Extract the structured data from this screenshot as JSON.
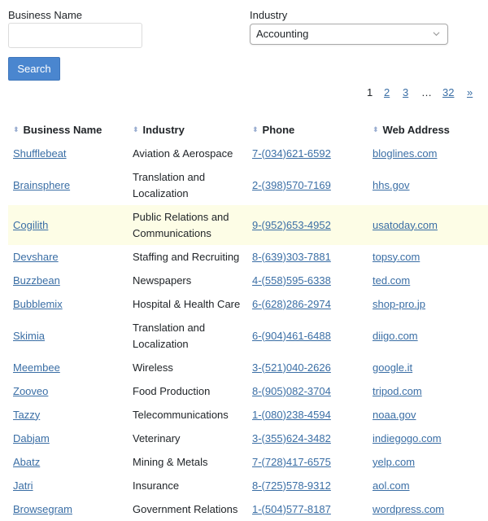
{
  "form": {
    "business_name_label": "Business Name",
    "business_name_value": "",
    "industry_label": "Industry",
    "industry_selected": "Accounting",
    "search_label": "Search"
  },
  "pagination": {
    "current": "1",
    "pages": [
      "2",
      "3"
    ],
    "ellipsis": "…",
    "last": "32",
    "next": "»"
  },
  "table": {
    "headers": [
      "Business Name",
      "Industry",
      "Phone",
      "Web Address"
    ],
    "rows": [
      {
        "name": "Shufflebeat",
        "industry": "Aviation & Aerospace",
        "phone": "7-(034)621-6592",
        "web": "bloglines.com"
      },
      {
        "name": "Brainsphere",
        "industry": "Translation and Localization",
        "phone": "2-(398)570-7169",
        "web": "hhs.gov"
      },
      {
        "name": "Cogilith",
        "industry": "Public Relations and Communications",
        "phone": "9-(952)653-4952",
        "web": "usatoday.com"
      },
      {
        "name": "Devshare",
        "industry": "Staffing and Recruiting",
        "phone": "8-(639)303-7881",
        "web": "topsy.com"
      },
      {
        "name": "Buzzbean",
        "industry": "Newspapers",
        "phone": "4-(558)595-6338",
        "web": "ted.com"
      },
      {
        "name": "Bubblemix",
        "industry": "Hospital & Health Care",
        "phone": "6-(628)286-2974",
        "web": "shop-pro.jp"
      },
      {
        "name": "Skimia",
        "industry": "Translation and Localization",
        "phone": "6-(904)461-6488",
        "web": "diigo.com"
      },
      {
        "name": "Meembee",
        "industry": "Wireless",
        "phone": "3-(521)040-2626",
        "web": "google.it"
      },
      {
        "name": "Zooveo",
        "industry": "Food Production",
        "phone": "8-(905)082-3704",
        "web": "tripod.com"
      },
      {
        "name": "Tazzy",
        "industry": "Telecommunications",
        "phone": "1-(080)238-4594",
        "web": "noaa.gov"
      },
      {
        "name": "Dabjam",
        "industry": "Veterinary",
        "phone": "3-(355)624-3482",
        "web": "indiegogo.com"
      },
      {
        "name": "Abatz",
        "industry": "Mining & Metals",
        "phone": "7-(728)417-6575",
        "web": "yelp.com"
      },
      {
        "name": "Jatri",
        "industry": "Insurance",
        "phone": "8-(725)578-9312",
        "web": "aol.com"
      },
      {
        "name": "Browsegram",
        "industry": "Government Relations",
        "phone": "1-(504)577-8187",
        "web": "wordpress.com"
      }
    ]
  }
}
